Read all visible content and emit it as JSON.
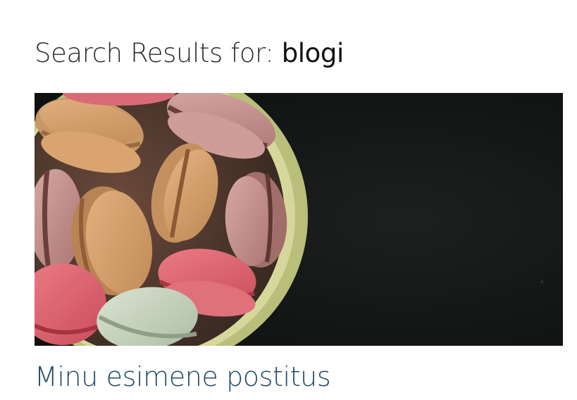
{
  "search": {
    "prefix": "Search Results for: ",
    "query": "blogi"
  },
  "post": {
    "title": "Minu esimene postitus",
    "image": "macarons-in-bowl-photo"
  },
  "colors": {
    "heading": "#2b2b2b",
    "post_title": "#1f4a66",
    "image_background": "#151716"
  }
}
